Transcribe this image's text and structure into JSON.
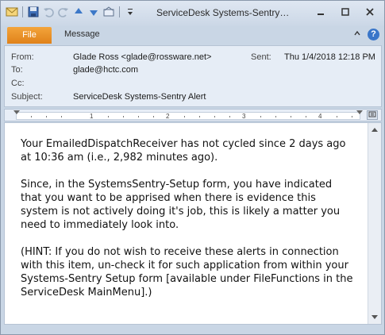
{
  "window": {
    "title": "ServiceDesk Systems-Sentry A..."
  },
  "qat": {
    "icons": [
      "mail-icon",
      "save-icon",
      "undo-icon",
      "redo-icon",
      "up-arrow-icon",
      "down-arrow-icon",
      "reply-icon",
      "qat-customize-icon"
    ]
  },
  "ribbon": {
    "file_tab": "File",
    "message_tab": "Message",
    "help_glyph": "?"
  },
  "header": {
    "from_label": "From:",
    "from_value": "Glade Ross <glade@rossware.net>",
    "sent_label": "Sent:",
    "sent_value": "Thu 1/4/2018 12:18 PM",
    "to_label": "To:",
    "to_value": "glade@hctc.com",
    "cc_label": "Cc:",
    "cc_value": "",
    "subject_label": "Subject:",
    "subject_value": "ServiceDesk Systems-Sentry Alert"
  },
  "ruler": {
    "numbers": [
      "1",
      "2",
      "3",
      "4"
    ]
  },
  "body": {
    "para1": "Your EmailedDispatchReceiver has not cycled since 2 days ago at 10:36 am (i.e., 2,982 minutes ago).",
    "para2": "Since, in the SystemsSentry-Setup form, you have indicated that you want to be apprised when there is evidence this system is not actively doing it's job, this is likely a matter you need to immediately look into.",
    "para3": "(HINT: If you do not wish to receive these alerts in connection with this item, un-check it for such application from within your Systems-Sentry Setup form [available under FileFunctions in the ServiceDesk MainMenu].)"
  }
}
